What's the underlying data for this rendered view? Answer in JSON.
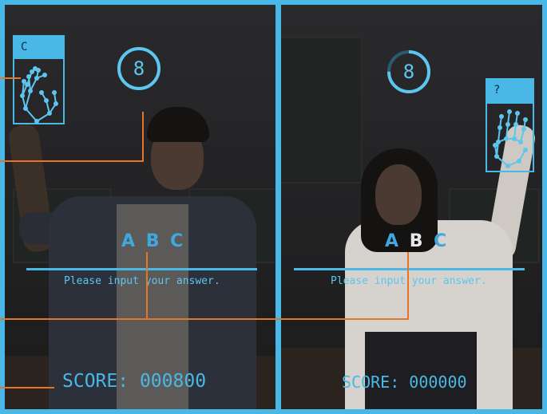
{
  "players": [
    {
      "id": "left",
      "timer": "8",
      "timer_fraction": 1.0,
      "gesture_label": "C",
      "letters": [
        "A",
        "B",
        "C"
      ],
      "highlighted_letter_index": -1,
      "prompt": "Please input your answer.",
      "score_label": "SCORE:",
      "score_value": "000800"
    },
    {
      "id": "right",
      "timer": "8",
      "timer_fraction": 0.75,
      "gesture_label": "?",
      "letters": [
        "A",
        "B",
        "C"
      ],
      "highlighted_letter_index": 1,
      "prompt": "Please input your answer.",
      "score_label": "SCORE:",
      "score_value": "000000"
    }
  ],
  "colors": {
    "accent": "#4ab8e6",
    "callout": "#e8742a",
    "letter": "#3fa9df",
    "highlight": "#e8e8e8"
  },
  "icons": {
    "timer": "ring-timer",
    "hand": "hand-skeleton-icon"
  }
}
